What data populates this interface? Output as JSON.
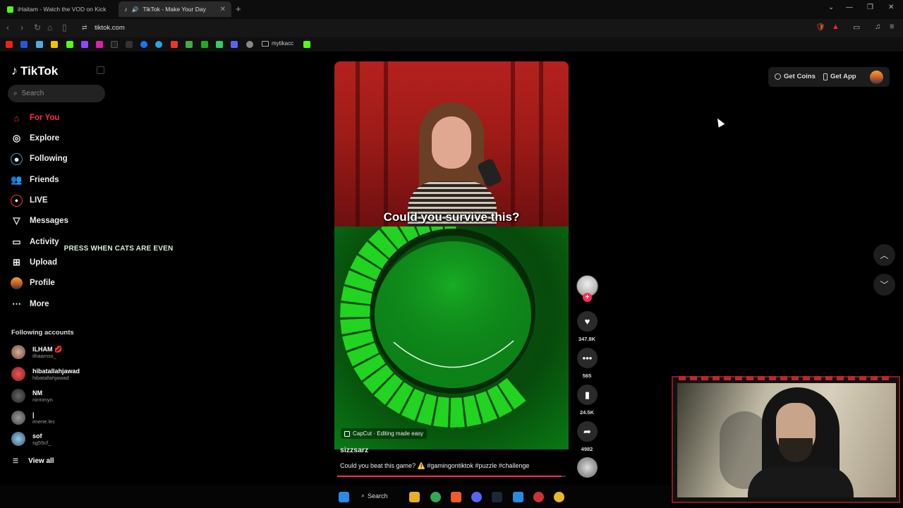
{
  "browser": {
    "tabs": [
      {
        "title": "iHaitam - Watch the VOD on Kick",
        "active": false
      },
      {
        "title": "TikTok - Make Your Day",
        "active": true
      }
    ],
    "url": "tiktok.com",
    "bookmark_folder": "mytikacc"
  },
  "sidebar": {
    "logo": "TikTok",
    "search_placeholder": "Search",
    "nav": [
      {
        "label": "For You",
        "icon": "home-icon",
        "active": true
      },
      {
        "label": "Explore",
        "icon": "compass-icon"
      },
      {
        "label": "Following",
        "icon": "following-icon"
      },
      {
        "label": "Friends",
        "icon": "friends-icon"
      },
      {
        "label": "LIVE",
        "icon": "live-icon"
      },
      {
        "label": "Messages",
        "icon": "send-icon"
      },
      {
        "label": "Activity",
        "icon": "activity-icon"
      },
      {
        "label": "Upload",
        "icon": "upload-icon"
      },
      {
        "label": "Profile",
        "icon": "profile-avatar"
      },
      {
        "label": "More",
        "icon": "more-icon"
      }
    ],
    "following_title": "Following accounts",
    "accounts": [
      {
        "name": "ILHAM 💋",
        "handle": "ilhaamss_"
      },
      {
        "name": "hibatallahjawad",
        "handle": "hibatallahjawad"
      },
      {
        "name": "NM",
        "handle": "nirmmyn"
      },
      {
        "name": "|",
        "handle": "imene.lec"
      },
      {
        "name": "sof",
        "handle": "sg55cf_"
      }
    ],
    "view_all": "View all"
  },
  "video": {
    "caption_overlay": "Could you survive this?",
    "game_text": "PRESS WHEN CATS ARE EVEN",
    "capcut_label": "CapCut · Editing made easy",
    "username": "sizzsarz",
    "description": "Could you beat this game? ⚠️ #gamingontiktok #puzzle #challenge",
    "progress": 0.98
  },
  "actions": {
    "likes": "347.8K",
    "comments": "565",
    "saves": "24.5K",
    "shares": "4982"
  },
  "topbar": {
    "get_coins": "Get Coins",
    "get_app": "Get App"
  },
  "taskbar": {
    "search": "Search"
  },
  "colors": {
    "brand": "#fe2c55",
    "game_green": "#22d322"
  }
}
